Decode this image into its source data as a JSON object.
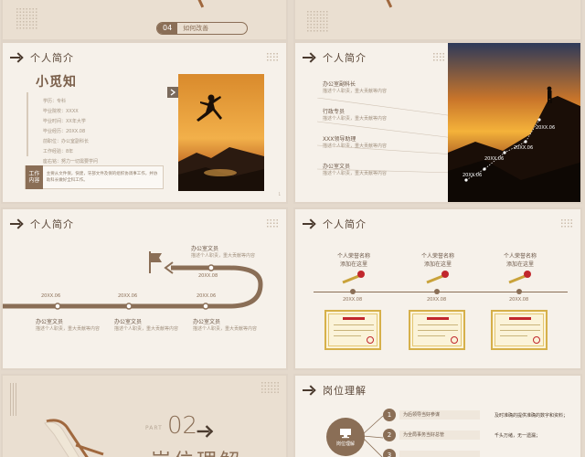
{
  "top_left": {
    "number": "04",
    "caption": "如何改善"
  },
  "slide1": {
    "title": "个人简介",
    "name": "小觅知",
    "info": [
      "学历：专科",
      "毕业院校：XXXX",
      "毕业时间：XX年大学",
      "毕业经历：20XX.08",
      "前职位：办公室副科长",
      "工作经验：8年",
      "座右铭：努力一切需要学问"
    ],
    "content_label": "工作内容",
    "content_text": "主要从文件保，快建，牙部文件及保的组织协调事工作，并协助科长做好全科工作。"
  },
  "slide2": {
    "title": "个人简介",
    "roles": [
      {
        "title": "办公室副科长",
        "desc": "描述个人职责，重大贡献等内容"
      },
      {
        "title": "行政专员",
        "desc": "描述个人职责，重大贡献等内容"
      },
      {
        "title": "XXX领导助理",
        "desc": "描述个人职责，重大贡献等内容"
      },
      {
        "title": "办公室文员",
        "desc": "描述个人职责，重大贡献等内容"
      }
    ],
    "dates": [
      "20XX.06",
      "20XX.06",
      "20XX.06",
      "20XX.06"
    ]
  },
  "slide3": {
    "title": "个人简介",
    "top_role": {
      "title": "办公室文员",
      "desc": "描述个人职责，重大贡献等内容",
      "date": "20XX.08"
    },
    "dates": [
      "20XX.06",
      "20XX.06",
      "20XX.06"
    ],
    "roles": [
      {
        "title": "办公室文员",
        "desc": "描述个人职责，重大贡献等内容"
      },
      {
        "title": "办公室文员",
        "desc": "描述个人职责，重大贡献等内容"
      },
      {
        "title": "办公室文员",
        "desc": "描述个人职责，重大贡献等内容"
      }
    ]
  },
  "slide4": {
    "title": "个人简介",
    "awards": [
      {
        "name": "个人荣誉名称",
        "sub": "添加在这里",
        "date": "20XX.08"
      },
      {
        "name": "个人荣誉名称",
        "sub": "添加在这里",
        "date": "20XX.08"
      },
      {
        "name": "个人荣誉名称",
        "sub": "添加在这里",
        "date": "20XX.08"
      }
    ]
  },
  "slide5": {
    "part": "PART",
    "number": "02",
    "title": "岗位理解"
  },
  "slide6": {
    "title": "岗位理解",
    "items": [
      {
        "num": "1",
        "label": "为后领导当好参谋",
        "desc": "及时准确的提供准确的数字和资料；"
      },
      {
        "num": "2",
        "label": "为全局事务当好总管",
        "desc": "千头万绪，无一遗漏；"
      },
      {
        "num": "3",
        "label": "",
        "desc": ""
      }
    ],
    "center_label": "岗位理解"
  },
  "colors": {
    "accent": "#8a6e56",
    "bg": "#f6f1ea",
    "dark": "#4a3a2e"
  }
}
